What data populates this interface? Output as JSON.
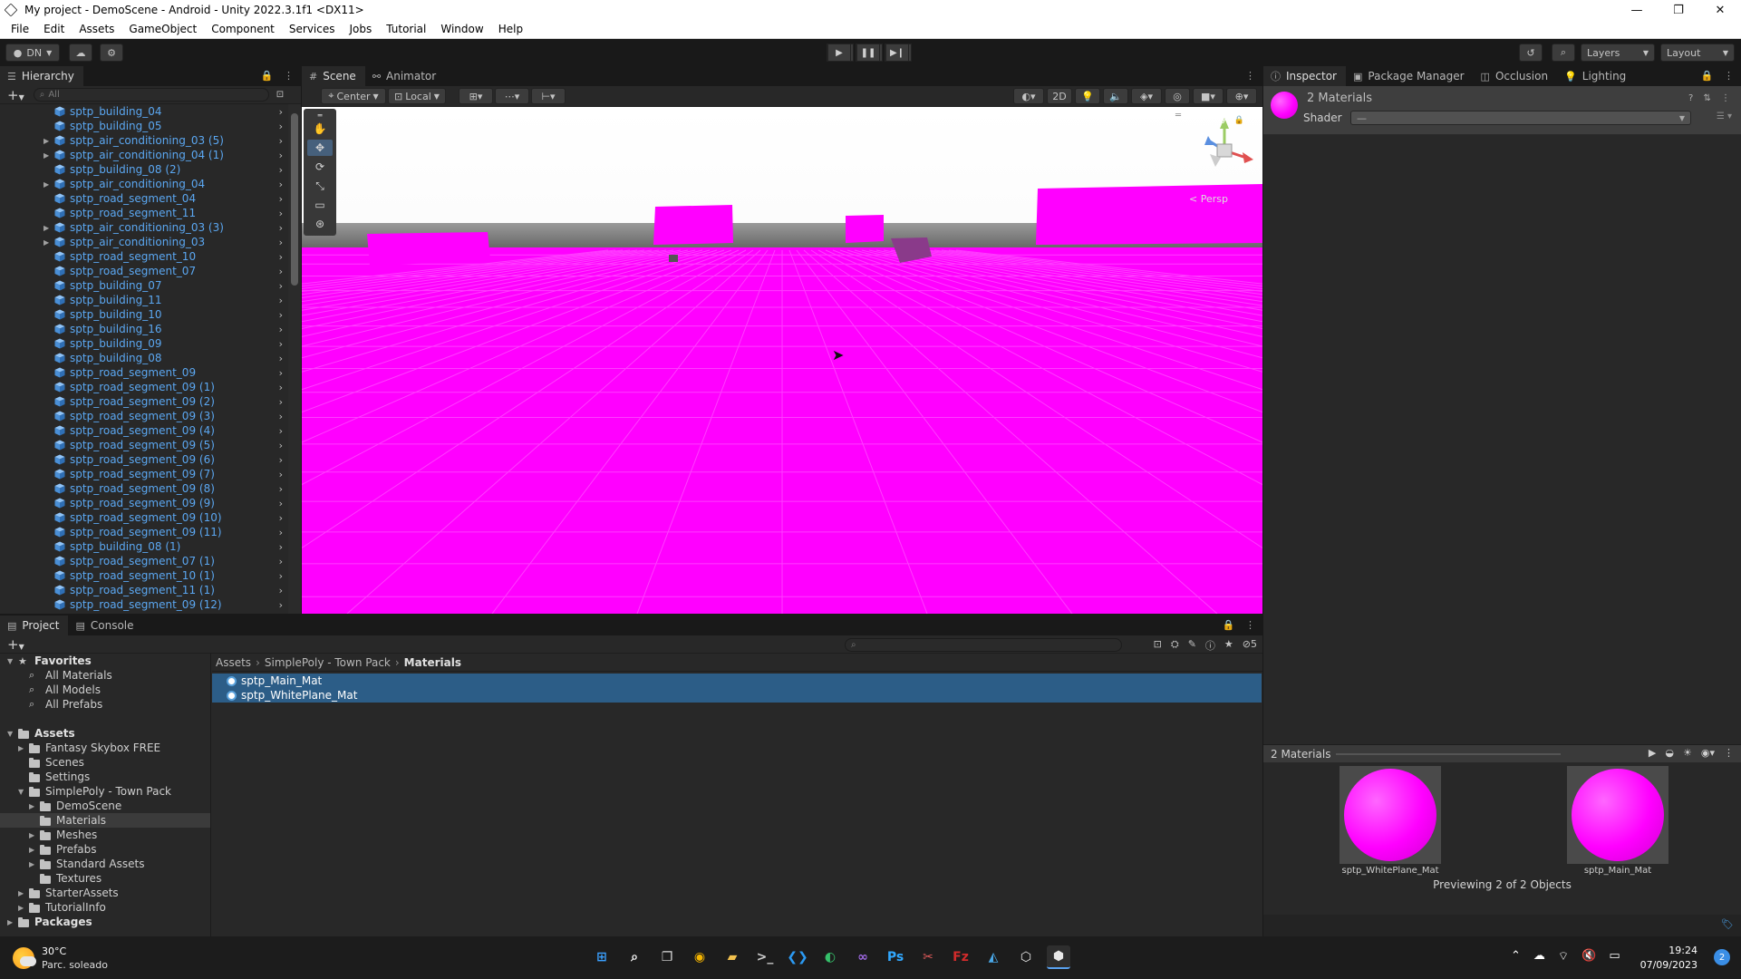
{
  "window": {
    "title": "My project - DemoScene - Android - Unity 2022.3.1f1 <DX11>",
    "minimize": "—",
    "maximize": "❐",
    "close": "✕"
  },
  "menu": [
    "File",
    "Edit",
    "Assets",
    "GameObject",
    "Component",
    "Services",
    "Jobs",
    "Tutorial",
    "Window",
    "Help"
  ],
  "toolbar": {
    "account_label": "DN",
    "layers_label": "Layers",
    "layout_label": "Layout"
  },
  "hierarchy": {
    "tab": "Hierarchy",
    "search_placeholder": "All",
    "items": [
      {
        "name": "sptp_building_04",
        "expandable": false
      },
      {
        "name": "sptp_building_05",
        "expandable": false
      },
      {
        "name": "sptp_air_conditioning_03 (5)",
        "expandable": true
      },
      {
        "name": "sptp_air_conditioning_04 (1)",
        "expandable": true
      },
      {
        "name": "sptp_building_08 (2)",
        "expandable": false
      },
      {
        "name": "sptp_air_conditioning_04",
        "expandable": true
      },
      {
        "name": "sptp_road_segment_04",
        "expandable": false
      },
      {
        "name": "sptp_road_segment_11",
        "expandable": false
      },
      {
        "name": "sptp_air_conditioning_03 (3)",
        "expandable": true
      },
      {
        "name": "sptp_air_conditioning_03",
        "expandable": true
      },
      {
        "name": "sptp_road_segment_10",
        "expandable": false
      },
      {
        "name": "sptp_road_segment_07",
        "expandable": false
      },
      {
        "name": "sptp_building_07",
        "expandable": false
      },
      {
        "name": "sptp_building_11",
        "expandable": false
      },
      {
        "name": "sptp_building_10",
        "expandable": false
      },
      {
        "name": "sptp_building_16",
        "expandable": false
      },
      {
        "name": "sptp_building_09",
        "expandable": false
      },
      {
        "name": "sptp_building_08",
        "expandable": false
      },
      {
        "name": "sptp_road_segment_09",
        "expandable": false
      },
      {
        "name": "sptp_road_segment_09 (1)",
        "expandable": false
      },
      {
        "name": "sptp_road_segment_09 (2)",
        "expandable": false
      },
      {
        "name": "sptp_road_segment_09 (3)",
        "expandable": false
      },
      {
        "name": "sptp_road_segment_09 (4)",
        "expandable": false
      },
      {
        "name": "sptp_road_segment_09 (5)",
        "expandable": false
      },
      {
        "name": "sptp_road_segment_09 (6)",
        "expandable": false
      },
      {
        "name": "sptp_road_segment_09 (7)",
        "expandable": false
      },
      {
        "name": "sptp_road_segment_09 (8)",
        "expandable": false
      },
      {
        "name": "sptp_road_segment_09 (9)",
        "expandable": false
      },
      {
        "name": "sptp_road_segment_09 (10)",
        "expandable": false
      },
      {
        "name": "sptp_road_segment_09 (11)",
        "expandable": false
      },
      {
        "name": "sptp_building_08 (1)",
        "expandable": false
      },
      {
        "name": "sptp_road_segment_07 (1)",
        "expandable": false
      },
      {
        "name": "sptp_road_segment_10 (1)",
        "expandable": false
      },
      {
        "name": "sptp_road_segment_11 (1)",
        "expandable": false
      },
      {
        "name": "sptp_road_segment_09 (12)",
        "expandable": false
      }
    ]
  },
  "scene": {
    "tabs": [
      "Scene",
      "Animator"
    ],
    "pivot_label": "Center",
    "space_label": "Local",
    "mode_2d": "2D",
    "persp_label": "< Persp",
    "gizmo_axis_y": "y",
    "gizmo_axis_x": "x",
    "gizmo_axis_z": "z"
  },
  "inspector": {
    "tabs": [
      "Inspector",
      "Package Manager",
      "Occlusion",
      "Lighting"
    ],
    "header_title": "2 Materials",
    "shader_label": "Shader",
    "shader_value": "—",
    "preview_title": "2 Materials",
    "preview_items": [
      "sptp_WhitePlane_Mat",
      "sptp_Main_Mat"
    ],
    "previewing_text": "Previewing 2 of 2 Objects",
    "colors": {
      "material": "#ff00ff"
    }
  },
  "project": {
    "tabs": [
      "Project",
      "Console"
    ],
    "hidden_count": "5",
    "breadcrumb": [
      "Assets",
      "SimplePoly - Town Pack",
      "Materials"
    ],
    "files": [
      "sptp_Main_Mat",
      "sptp_WhitePlane_Mat"
    ],
    "tree": [
      {
        "label": "Favorites",
        "depth": 0,
        "bold": true,
        "arrow": "down",
        "icon": "star-icon"
      },
      {
        "label": "All Materials",
        "depth": 1,
        "icon": "search-icon"
      },
      {
        "label": "All Models",
        "depth": 1,
        "icon": "search-icon"
      },
      {
        "label": "All Prefabs",
        "depth": 1,
        "icon": "search-icon"
      },
      {
        "label": "",
        "depth": -1
      },
      {
        "label": "Assets",
        "depth": 0,
        "bold": true,
        "arrow": "down",
        "icon": "folder-icon"
      },
      {
        "label": "Fantasy Skybox FREE",
        "depth": 1,
        "arrow": "right",
        "icon": "folder-icon"
      },
      {
        "label": "Scenes",
        "depth": 1,
        "icon": "folder-icon"
      },
      {
        "label": "Settings",
        "depth": 1,
        "icon": "folder-icon"
      },
      {
        "label": "SimplePoly - Town Pack",
        "depth": 1,
        "arrow": "down",
        "icon": "folder-icon"
      },
      {
        "label": "DemoScene",
        "depth": 2,
        "arrow": "right",
        "icon": "folder-icon"
      },
      {
        "label": "Materials",
        "depth": 2,
        "icon": "folder-icon",
        "selected": true
      },
      {
        "label": "Meshes",
        "depth": 2,
        "arrow": "right",
        "icon": "folder-icon"
      },
      {
        "label": "Prefabs",
        "depth": 2,
        "arrow": "right",
        "icon": "folder-icon"
      },
      {
        "label": "Standard Assets",
        "depth": 2,
        "arrow": "right",
        "icon": "folder-icon"
      },
      {
        "label": "Textures",
        "depth": 2,
        "icon": "folder-icon"
      },
      {
        "label": "StarterAssets",
        "depth": 1,
        "arrow": "right",
        "icon": "folder-icon"
      },
      {
        "label": "TutorialInfo",
        "depth": 1,
        "arrow": "right",
        "icon": "folder-icon"
      },
      {
        "label": "Packages",
        "depth": 0,
        "bold": true,
        "arrow": "right",
        "icon": "folder-icon"
      }
    ]
  },
  "taskbar": {
    "weather_temp": "30°C",
    "weather_desc": "Parc. soleado",
    "time": "19:24",
    "date": "07/09/2023",
    "notification_count": "2",
    "apps": [
      {
        "name": "windows-start-icon",
        "glyph": "⊞",
        "color": "#3aa0ff"
      },
      {
        "name": "search-icon",
        "glyph": "⌕",
        "color": "#ffffff"
      },
      {
        "name": "task-view-icon",
        "glyph": "❐",
        "color": "#dddddd"
      },
      {
        "name": "chrome-icon",
        "glyph": "◉",
        "color": "#f4b400"
      },
      {
        "name": "file-explorer-icon",
        "glyph": "▰",
        "color": "#f2c14e"
      },
      {
        "name": "terminal-icon",
        "glyph": ">_",
        "color": "#cccccc"
      },
      {
        "name": "vscode-icon",
        "glyph": "❮❯",
        "color": "#2b9af3"
      },
      {
        "name": "edge-icon",
        "glyph": "◐",
        "color": "#35c06a"
      },
      {
        "name": "visual-studio-icon",
        "glyph": "∞",
        "color": "#a26be8"
      },
      {
        "name": "photoshop-icon",
        "glyph": "Ps",
        "color": "#31a8ff"
      },
      {
        "name": "snipping-tool-icon",
        "glyph": "✂",
        "color": "#e05a5a"
      },
      {
        "name": "filezilla-icon",
        "glyph": "Fz",
        "color": "#d22b2b"
      },
      {
        "name": "paint-icon",
        "glyph": "◭",
        "color": "#4aa8e8"
      },
      {
        "name": "unity-hub-icon",
        "glyph": "⬡",
        "color": "#e8e8e8"
      },
      {
        "name": "unity-editor-icon",
        "glyph": "⬢",
        "color": "#e8e8e8"
      }
    ]
  }
}
